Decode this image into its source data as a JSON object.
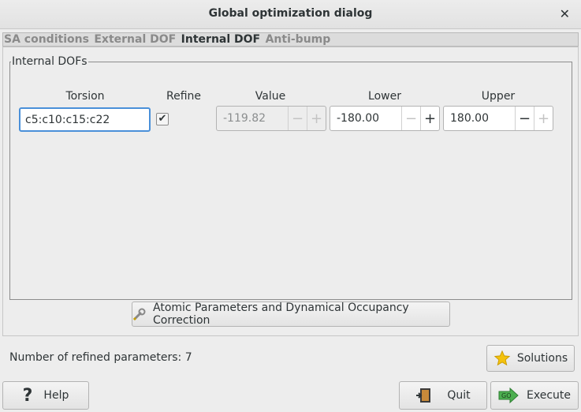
{
  "window": {
    "title": "Global optimization dialog"
  },
  "tabs": [
    {
      "label": "SA conditions"
    },
    {
      "label": "External DOF"
    },
    {
      "label": "Internal DOF",
      "active": true
    },
    {
      "label": "Anti-bump"
    }
  ],
  "internal_dofs": {
    "group_title": "Internal DOFs",
    "columns": {
      "torsion": "Torsion",
      "refine": "Refine",
      "value": "Value",
      "lower": "Lower",
      "upper": "Upper"
    },
    "row": {
      "torsion": "c5:c10:c15:c22",
      "refine_checked": true,
      "value": "-119.82",
      "lower": "-180.00",
      "upper": "180.00"
    }
  },
  "buttons": {
    "atomic": "Atomic Parameters and Dynamical Occupancy Correction",
    "solutions": "Solutions",
    "help": "Help",
    "quit": "Quit",
    "execute": "Execute",
    "minus": "−",
    "plus": "+"
  },
  "status": {
    "refined_params": "Number of refined parameters: 7"
  },
  "icons": {
    "close": "close-icon",
    "check": "check-icon",
    "wrench": "wrench-icon",
    "star": "star-icon",
    "help": "question-icon",
    "quit": "exit-door-icon",
    "execute": "go-arrow-icon"
  },
  "colors": {
    "focus": "#4a90d9",
    "star": "#f4c20d",
    "go": "#4caf50"
  }
}
